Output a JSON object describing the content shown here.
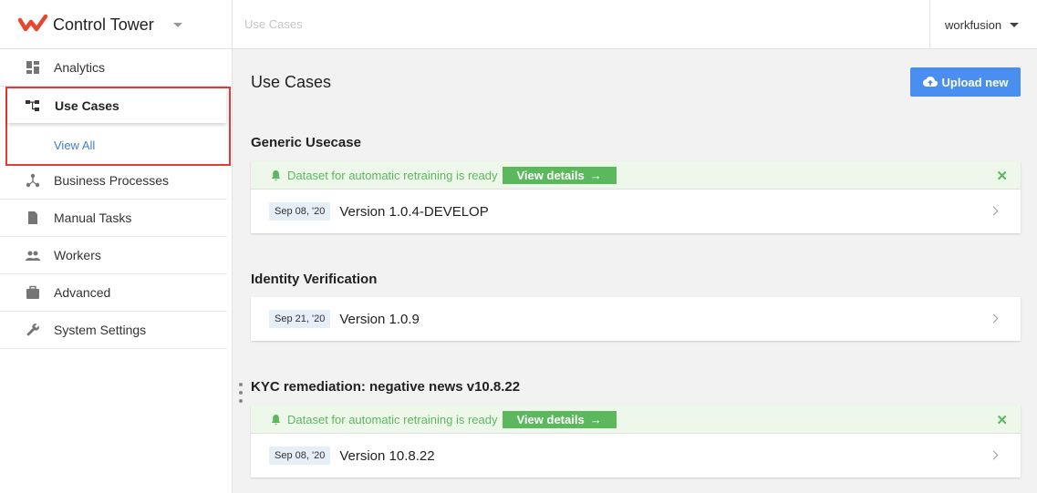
{
  "app": {
    "title": "Control Tower",
    "breadcrumb": "Use Cases",
    "user": "workfusion",
    "brand_color": "#e8462e"
  },
  "sidebar": {
    "items": [
      {
        "label": "Analytics",
        "icon": "dashboard-icon"
      },
      {
        "label": "Use Cases",
        "icon": "hierarchy-icon",
        "active": true
      },
      {
        "label": "Business Processes",
        "icon": "process-icon"
      },
      {
        "label": "Manual Tasks",
        "icon": "document-icon"
      },
      {
        "label": "Workers",
        "icon": "people-icon"
      },
      {
        "label": "Advanced",
        "icon": "briefcase-icon"
      },
      {
        "label": "System Settings",
        "icon": "wrench-icon"
      }
    ],
    "sub_item": "View All"
  },
  "main": {
    "title": "Use Cases",
    "upload_label": "Upload new",
    "groups": [
      {
        "title": "Generic Usecase",
        "alert": {
          "text": "Dataset for automatic retraining is ready",
          "button": "View details",
          "arrow": "→",
          "close": "✕"
        },
        "date": "Sep 08, '20",
        "version": "Version 1.0.4-DEVELOP"
      },
      {
        "title": "Identity Verification",
        "date": "Sep 21, '20",
        "version": "Version 1.0.9"
      },
      {
        "title": "KYC remediation: negative news v10.8.22",
        "alert": {
          "text": "Dataset for automatic retraining is ready",
          "button": "View details",
          "arrow": "→",
          "close": "✕"
        },
        "date": "Sep 08, '20",
        "version": "Version 10.8.22"
      }
    ]
  },
  "colors": {
    "accent": "#4a8ef0",
    "success": "#5cb85c",
    "highlight": "#e53935",
    "link": "#3f7fd6"
  }
}
